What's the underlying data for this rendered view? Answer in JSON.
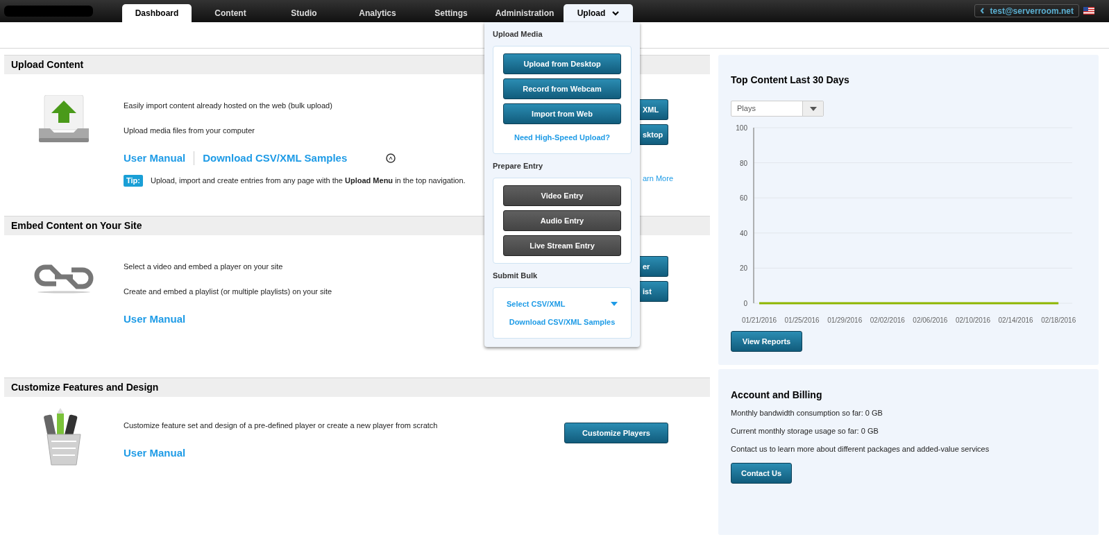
{
  "nav": {
    "tabs": [
      {
        "label": "Dashboard",
        "selected": true,
        "expanded": false
      },
      {
        "label": "Content",
        "selected": false,
        "expanded": false
      },
      {
        "label": "Studio",
        "selected": false,
        "expanded": false
      },
      {
        "label": "Analytics",
        "selected": false,
        "expanded": false
      },
      {
        "label": "Settings",
        "selected": false,
        "expanded": false
      },
      {
        "label": "Administration",
        "selected": false,
        "expanded": false
      },
      {
        "label": "Upload",
        "selected": false,
        "expanded": true
      }
    ],
    "account": "test@serverroom.net"
  },
  "sections": [
    {
      "title": "Upload Content",
      "lines": [
        "Easily import content already hosted on the web (bulk upload)",
        "Upload media files from your computer"
      ],
      "links": [
        "User Manual",
        "Download CSV/XML Samples"
      ],
      "tip": {
        "badge": "Tip:",
        "text": "Upload, import and create entries from any page with the **Upload Menu** in the top navigation.",
        "link": "arn More"
      },
      "buttons": [
        "XML",
        "sktop"
      ]
    },
    {
      "title": "Embed Content on Your Site",
      "lines": [
        "Select a video and embed a player on your site",
        "Create and embed a playlist (or multiple playlists) on your site"
      ],
      "links": [
        "User Manual"
      ],
      "buttons": [
        "er",
        "ist"
      ]
    },
    {
      "title": "Customize Features and Design",
      "lines": [
        "Customize feature set and design of a pre-defined player or create a new player from scratch"
      ],
      "links": [
        "User Manual"
      ],
      "buttons": [
        "Customize Players"
      ]
    }
  ],
  "top_content": {
    "title": "Top Content Last 30 Days",
    "metric": "Plays",
    "chart_data": {
      "type": "line",
      "categories": [
        "01/21/2016",
        "01/25/2016",
        "01/29/2016",
        "02/02/2016",
        "02/06/2016",
        "02/10/2016",
        "02/14/2016",
        "02/18/2016"
      ],
      "series": [
        {
          "color": "#8db600",
          "values": [
            0,
            0,
            0,
            0,
            0,
            0,
            0,
            0
          ]
        }
      ],
      "ylim": [
        0,
        100
      ],
      "yticks": [
        0,
        20,
        40,
        60,
        80,
        100
      ],
      "grid": true
    },
    "button": "View Reports"
  },
  "account_billing": {
    "title": "Account and Billing",
    "lines": [
      "Monthly bandwidth consumption so far: 0 GB",
      "Current monthly storage usage so far: 0 GB",
      "Contact us to learn more about different packages and added-value services"
    ],
    "button": "Contact Us"
  },
  "upload_menu": {
    "groups": [
      {
        "title": "Upload Media",
        "items": [
          {
            "kind": "primary",
            "label": "Upload from Desktop"
          },
          {
            "kind": "primary",
            "label": "Record from Webcam"
          },
          {
            "kind": "primary",
            "label": "Import from Web"
          },
          {
            "kind": "link",
            "label": "Need High-Speed Upload?"
          }
        ]
      },
      {
        "title": "Prepare Entry",
        "items": [
          {
            "kind": "dark",
            "label": "Video Entry"
          },
          {
            "kind": "dark",
            "label": "Audio Entry"
          },
          {
            "kind": "dark",
            "label": "Live Stream Entry"
          }
        ]
      },
      {
        "title": "Submit Bulk",
        "items": [
          {
            "kind": "dropdown",
            "label": "Select CSV/XML"
          },
          {
            "kind": "link",
            "label": "Download CSV/XML Samples"
          }
        ]
      }
    ]
  }
}
